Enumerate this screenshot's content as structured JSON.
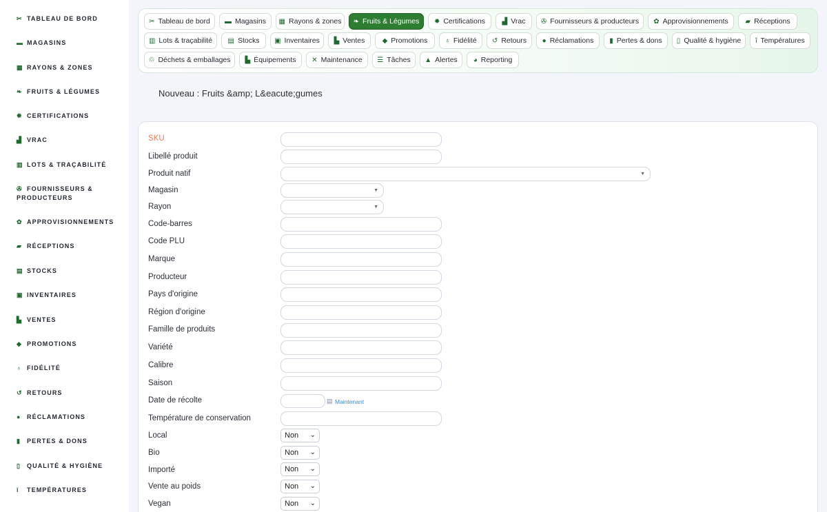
{
  "sidebar": {
    "items": [
      {
        "label": "TABLEAU DE BORD",
        "icon": "sprout-icon",
        "glyph": "✂"
      },
      {
        "label": "MAGASINS",
        "icon": "store-icon",
        "glyph": "▬"
      },
      {
        "label": "RAYONS & ZONES",
        "icon": "grid-icon",
        "glyph": "▦"
      },
      {
        "label": "FRUITS & LÉGUMES",
        "icon": "leaf-icon",
        "glyph": "❧"
      },
      {
        "label": "CERTIFICATIONS",
        "icon": "badge-icon",
        "glyph": "✹"
      },
      {
        "label": "VRAC",
        "icon": "boxes-icon",
        "glyph": "▟"
      },
      {
        "label": "LOTS & TRAÇABILITÉ",
        "icon": "barcode-icon",
        "glyph": "▥"
      },
      {
        "label_line1": "FOURNISSEURS &",
        "label_line2": "PRODUCTEURS",
        "icon": "tractor-icon",
        "glyph": "✇"
      },
      {
        "label": "APPROVISIONNEMENTS",
        "icon": "seedling-hand-icon",
        "glyph": "✿"
      },
      {
        "label": "RÉCEPTIONS",
        "icon": "truck-icon",
        "glyph": "▰"
      },
      {
        "label": "STOCKS",
        "icon": "warehouse-icon",
        "glyph": "▤"
      },
      {
        "label": "INVENTAIRES",
        "icon": "clipboard-icon",
        "glyph": "▣"
      },
      {
        "label": "VENTES",
        "icon": "cash-register-icon",
        "glyph": "▙"
      },
      {
        "label": "PROMOTIONS",
        "icon": "tag-icon",
        "glyph": "◆"
      },
      {
        "label": "FIDÉLITÉ",
        "icon": "award-icon",
        "glyph": "♁"
      },
      {
        "label": "RETOURS",
        "icon": "undo-icon",
        "glyph": "↺"
      },
      {
        "label": "RÉCLAMATIONS",
        "icon": "comment-icon",
        "glyph": "●"
      },
      {
        "label": "PERTES & DONS",
        "icon": "trash-icon",
        "glyph": "▮"
      },
      {
        "label": "QUALITÉ & HYGIÈNE",
        "icon": "soap-icon",
        "glyph": "▯"
      },
      {
        "label": "TEMPÉRATURES",
        "icon": "thermometer-icon",
        "glyph": "ǐ"
      }
    ]
  },
  "nav": {
    "chips": [
      {
        "label": "Tableau de bord",
        "icon": "sprout-icon",
        "glyph": "✂"
      },
      {
        "label": "Magasins",
        "icon": "store-icon",
        "glyph": "▬"
      },
      {
        "label": "Rayons & zones",
        "icon": "grid-icon",
        "glyph": "▦"
      },
      {
        "label": "Fruits & Légumes",
        "icon": "leaf-icon",
        "glyph": "❧"
      },
      {
        "label": "Certifications",
        "icon": "badge-icon",
        "glyph": "✹"
      },
      {
        "label": "Vrac",
        "icon": "boxes-icon",
        "glyph": "▟"
      },
      {
        "label": "Fournisseurs & producteurs",
        "icon": "tractor-icon",
        "glyph": "✇"
      },
      {
        "label": "Approvisionnements",
        "icon": "seedling-hand-icon",
        "glyph": "✿"
      },
      {
        "label": "Réceptions",
        "icon": "truck-icon",
        "glyph": "▰"
      },
      {
        "label": "Lots & traçabilité",
        "icon": "barcode-icon",
        "glyph": "▥"
      },
      {
        "label": "Stocks",
        "icon": "warehouse-icon",
        "glyph": "▤"
      },
      {
        "label": "Inventaires",
        "icon": "clipboard-icon",
        "glyph": "▣"
      },
      {
        "label": "Ventes",
        "icon": "cash-register-icon",
        "glyph": "▙"
      },
      {
        "label": "Promotions",
        "icon": "tag-icon",
        "glyph": "◆"
      },
      {
        "label": "Fidélité",
        "icon": "award-icon",
        "glyph": "♁"
      },
      {
        "label": "Retours",
        "icon": "undo-icon",
        "glyph": "↺"
      },
      {
        "label": "Réclamations",
        "icon": "comment-icon",
        "glyph": "●"
      },
      {
        "label": "Pertes & dons",
        "icon": "trash-icon",
        "glyph": "▮"
      },
      {
        "label": "Qualité & hygiène",
        "icon": "soap-icon",
        "glyph": "▯"
      },
      {
        "label": "Températures",
        "icon": "thermometer-icon",
        "glyph": "ǐ"
      },
      {
        "label": "Déchets & emballages",
        "icon": "recycle-icon",
        "glyph": "♲"
      },
      {
        "label": "Équipements",
        "icon": "toolbox-icon",
        "glyph": "▙"
      },
      {
        "label": "Maintenance",
        "icon": "tools-icon",
        "glyph": "✕"
      },
      {
        "label": "Tâches",
        "icon": "list-check-icon",
        "glyph": "☰"
      },
      {
        "label": "Alertes",
        "icon": "bell-icon",
        "glyph": "▲"
      },
      {
        "label": "Reporting",
        "icon": "chart-pie-icon",
        "glyph": "◕"
      }
    ],
    "active_index": 3
  },
  "page": {
    "title": "Nouveau : Fruits &amp; L&eacute;gumes"
  },
  "form": {
    "fields": [
      {
        "label": "SKU",
        "type": "text",
        "required": true,
        "value": ""
      },
      {
        "label": "Libellé produit",
        "type": "text",
        "value": ""
      },
      {
        "label": "Produit natif",
        "type": "select-wide",
        "value": ""
      },
      {
        "label": "Magasin",
        "type": "select",
        "value": ""
      },
      {
        "label": "Rayon",
        "type": "select",
        "value": ""
      },
      {
        "label": "Code-barres",
        "type": "text",
        "value": ""
      },
      {
        "label": "Code PLU",
        "type": "text",
        "value": ""
      },
      {
        "label": "Marque",
        "type": "text",
        "value": ""
      },
      {
        "label": "Producteur",
        "type": "text",
        "value": ""
      },
      {
        "label": "Pays d'origine",
        "type": "text",
        "value": ""
      },
      {
        "label": "Région d'origine",
        "type": "text",
        "value": ""
      },
      {
        "label": "Famille de produits",
        "type": "text",
        "value": ""
      },
      {
        "label": "Variété",
        "type": "text",
        "value": ""
      },
      {
        "label": "Calibre",
        "type": "text",
        "value": ""
      },
      {
        "label": "Saison",
        "type": "text",
        "value": ""
      },
      {
        "label": "Date de récolte",
        "type": "date",
        "value": "",
        "link": "Maintenant"
      },
      {
        "label": "Température de conservation",
        "type": "text",
        "value": ""
      },
      {
        "label": "Local",
        "type": "yesno",
        "value": "Non"
      },
      {
        "label": "Bio",
        "type": "yesno",
        "value": "Non"
      },
      {
        "label": "Importé",
        "type": "yesno",
        "value": "Non"
      },
      {
        "label": "Vente au poids",
        "type": "yesno",
        "value": "Non"
      },
      {
        "label": "Vegan",
        "type": "yesno",
        "value": "Non"
      }
    ]
  },
  "colors": {
    "accent": "#2e7d32",
    "required_label": "#f07b5a",
    "link": "#3a8ddb"
  }
}
